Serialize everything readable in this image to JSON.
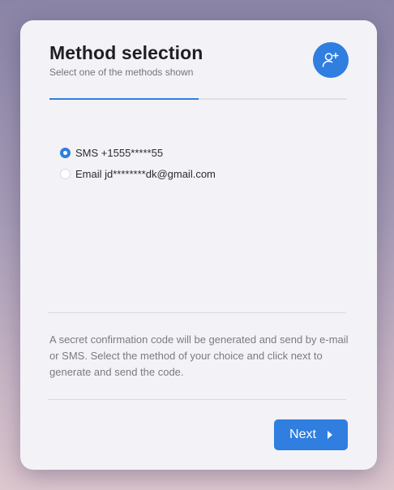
{
  "header": {
    "title": "Method selection",
    "subtitle": "Select one of the methods shown",
    "avatar_icon": "user-plus-icon"
  },
  "progress": {
    "fraction": 0.5
  },
  "methods": [
    {
      "label": "SMS +1555*****55",
      "checked": true
    },
    {
      "label": "Email jd********dk@gmail.com",
      "checked": false
    }
  ],
  "info_text": "A secret confirmation code will be generated and send by e-mail or SMS. Select the method of your choice and click next to generate and send the code.",
  "footer": {
    "next_label": "Next",
    "next_icon": "caret-right-icon"
  },
  "colors": {
    "accent": "#2f7ee0",
    "card": "#f3f3f7"
  }
}
